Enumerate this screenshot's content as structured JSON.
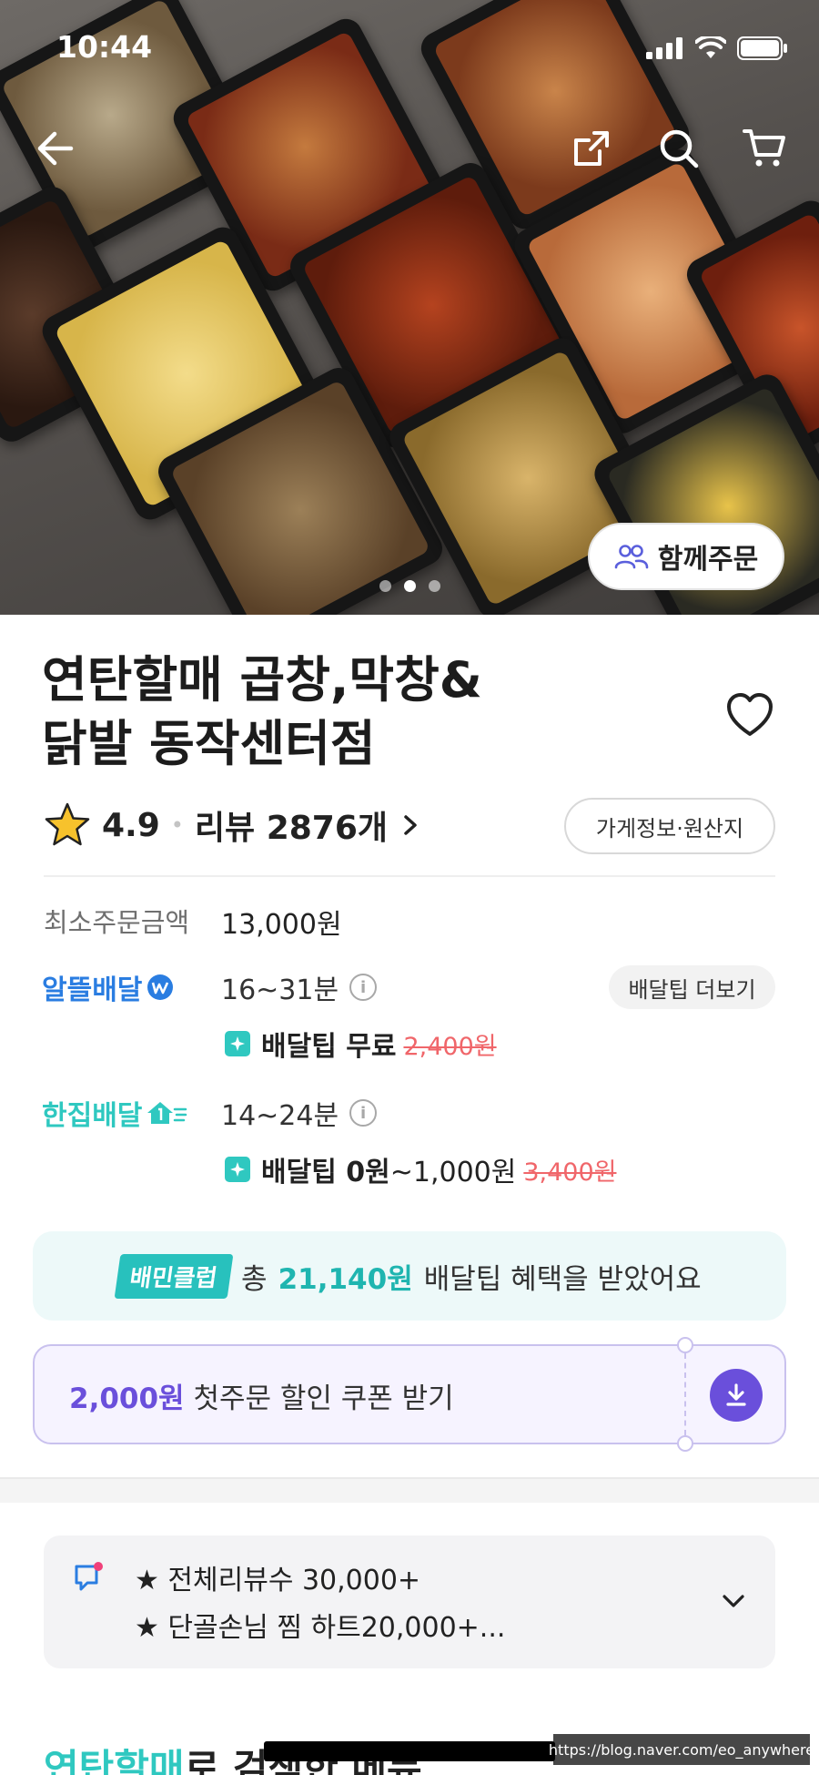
{
  "status_bar": {
    "time": "10:44"
  },
  "hero": {
    "group_order_label": "함께주문",
    "page_count": 3,
    "active_page": 2
  },
  "store": {
    "name_line1": "연탄할매 곱창,막창&",
    "name_line2": "닭발 동작센터점",
    "rating": "4.9",
    "review_label": "리뷰 2876개",
    "info_button": "가게정보·원산지"
  },
  "order": {
    "min_order_label": "최소주문금액",
    "min_order_value": "13,000원"
  },
  "delivery": {
    "more_tip_button": "배달팁 더보기",
    "altteul": {
      "brand": "알뜰배달",
      "time": "16~31분",
      "tip_label": "배달팁 무료",
      "tip_original": "2,400원"
    },
    "hanjip": {
      "brand": "한집배달",
      "time": "14~24분",
      "tip_bold": "배달팁 0원",
      "tip_range": "~1,000원",
      "tip_original": "3,400원"
    }
  },
  "club": {
    "badge": "배민클럽",
    "prefix": "총",
    "amount": "21,140원",
    "suffix": "배달팁 혜택을 받았어요"
  },
  "coupon": {
    "amount": "2,000원",
    "text": "첫주문 할인 쿠폰 받기"
  },
  "notice": {
    "line1": "★ 전체리뷰수 30,000+",
    "line2": "★ 단골손님 찜 하트20,000+..."
  },
  "menu_section": {
    "heading_brand": "연탄할매",
    "heading_rest": "로 검색한 메뉴"
  },
  "watermark": "https://blog.naver.com/eo_anywhere",
  "colors": {
    "mint": "#2fc8c0",
    "purple": "#6a4fdb",
    "strike_red": "#f0666a",
    "altteul_blue": "#2a7de1"
  },
  "icons": [
    "back-arrow-icon",
    "share-icon",
    "search-icon",
    "cart-icon",
    "people-icon",
    "heart-icon",
    "star-icon",
    "chevron-right-icon",
    "info-icon",
    "download-icon",
    "notice-icon",
    "chevron-down-icon"
  ]
}
